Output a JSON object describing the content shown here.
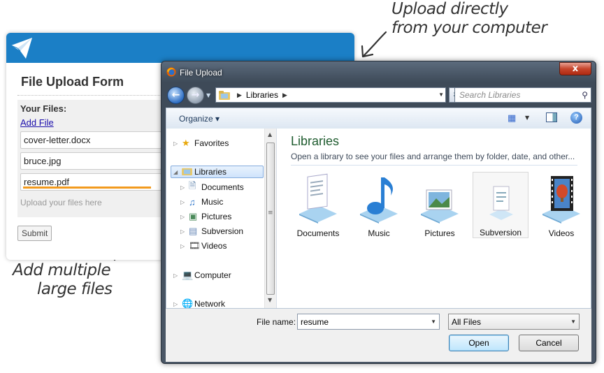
{
  "annotations": {
    "top_line1": "Upload directly",
    "top_line2": "from your computer",
    "bottom_line1": "Add multiple",
    "bottom_line2": "large files"
  },
  "form": {
    "title": "File Upload Form",
    "files_label": "Your Files:",
    "add_file": "Add File",
    "files": [
      {
        "name": "cover-letter.docx",
        "progress": 0
      },
      {
        "name": "bruce.jpg",
        "progress": 0
      },
      {
        "name": "resume.pdf",
        "progress": 1
      }
    ],
    "upload_hint": "Upload your files here",
    "submit": "Submit"
  },
  "dialog": {
    "title": "File Upload",
    "close": "x",
    "address": {
      "location": "Libraries"
    },
    "search_placeholder": "Search Libraries",
    "toolbar": {
      "organize": "Organize"
    },
    "nav": {
      "favorites": "Favorites",
      "libraries": "Libraries",
      "documents": "Documents",
      "music": "Music",
      "pictures": "Pictures",
      "subversion": "Subversion",
      "videos": "Videos",
      "computer": "Computer",
      "network": "Network"
    },
    "main": {
      "heading": "Libraries",
      "subheading": "Open a library to see your files and arrange them by folder, date, and other...",
      "items": [
        "Documents",
        "Music",
        "Pictures",
        "Subversion",
        "Videos"
      ]
    },
    "footer": {
      "file_name_label": "File name:",
      "file_name_value": "resume",
      "filter": "All Files",
      "open": "Open",
      "cancel": "Cancel"
    }
  },
  "colors": {
    "header_blue": "#1b7fc6",
    "progress_orange": "#f29a1e",
    "link_blue": "#1a0dab",
    "library_heading": "#1e5b2e"
  }
}
